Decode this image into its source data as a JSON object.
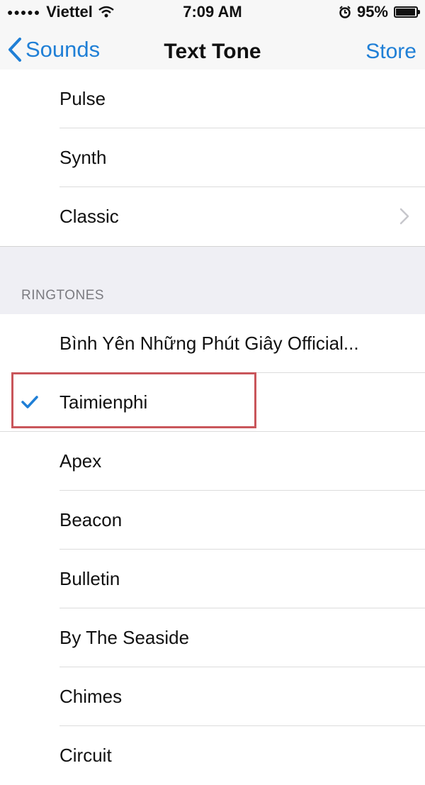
{
  "status_bar": {
    "signal": "●●●●●",
    "carrier": "Viettel",
    "time": "7:09 AM",
    "battery": "95%",
    "battery_level": 0.95
  },
  "nav": {
    "back_label": "Sounds",
    "title": "Text Tone",
    "store_label": "Store"
  },
  "alert_tones": [
    "Pulse",
    "Synth",
    "Classic"
  ],
  "ringtones_section": {
    "header": "RINGTONES",
    "items": [
      "Bình Yên Những Phút Giây  Official...",
      "Taimienphi",
      "Apex",
      "Beacon",
      "Bulletin",
      "By The Seaside",
      "Chimes",
      "Circuit"
    ],
    "selected": "Taimienphi"
  },
  "colors": {
    "accent": "#1f7fd6",
    "highlight": "#c9565b",
    "section_bg": "#efeff4"
  }
}
